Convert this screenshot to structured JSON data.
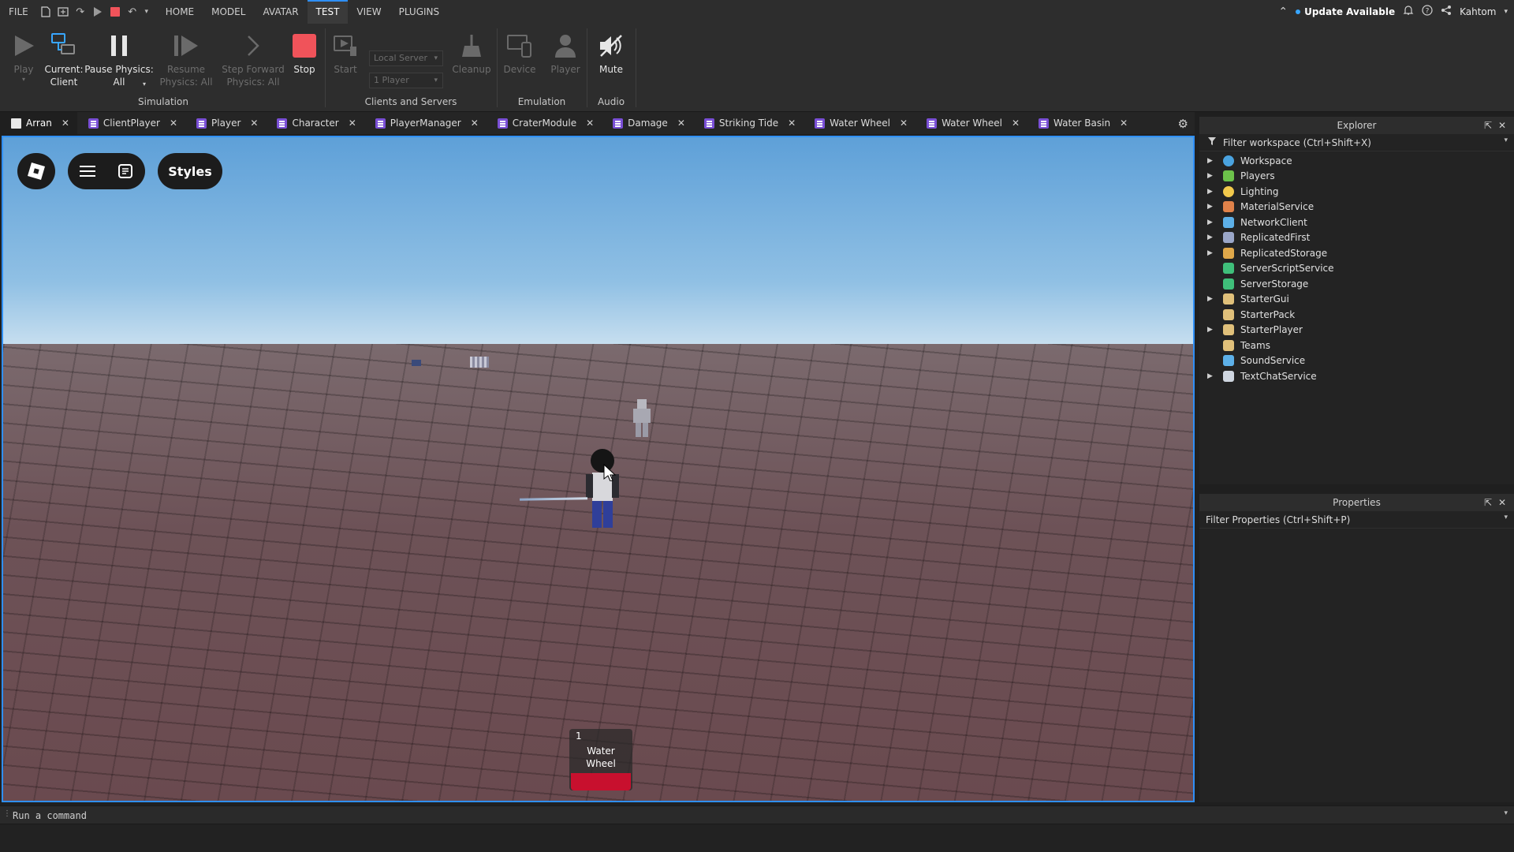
{
  "menubar": {
    "file": "FILE",
    "tabs": [
      "HOME",
      "MODEL",
      "AVATAR",
      "TEST",
      "VIEW",
      "PLUGINS"
    ],
    "active_tab": "TEST",
    "update_text": "Update Available",
    "username": "Kahtom"
  },
  "ribbon": {
    "play_label": "Play",
    "current_label_1": "Current:",
    "current_label_2": "Client",
    "pause_label_1": "Pause Physics:",
    "pause_label_2": "All",
    "resume_label_1": "Resume",
    "resume_label_2": "Physics: All",
    "step_label_1": "Step Forward",
    "step_label_2": "Physics: All",
    "stop_label": "Stop",
    "start_label": "Start",
    "server_select": "Local Server",
    "players_select": "1 Player",
    "cleanup_label": "Cleanup",
    "device_label": "Device",
    "player_label": "Player",
    "mute_label": "Mute",
    "group_simulation": "Simulation",
    "group_clients": "Clients and Servers",
    "group_emulation": "Emulation",
    "group_audio": "Audio",
    "stop_color": "#f0535a"
  },
  "doc_tabs": [
    {
      "label": "Arran",
      "icon": "doc"
    },
    {
      "label": "ClientPlayer",
      "icon": "script"
    },
    {
      "label": "Player",
      "icon": "script"
    },
    {
      "label": "Character",
      "icon": "script"
    },
    {
      "label": "PlayerManager",
      "icon": "script"
    },
    {
      "label": "CraterModule",
      "icon": "script"
    },
    {
      "label": "Damage",
      "icon": "script"
    },
    {
      "label": "Striking Tide",
      "icon": "script"
    },
    {
      "label": "Water Wheel",
      "icon": "script"
    },
    {
      "label": "Water Wheel",
      "icon": "script"
    },
    {
      "label": "Water Basin",
      "icon": "script"
    }
  ],
  "viewport": {
    "styles_label": "Styles",
    "hotbar": {
      "slot": "1",
      "name_1": "Water",
      "name_2": "Wheel"
    }
  },
  "command_bar": {
    "placeholder": "Run a command"
  },
  "explorer": {
    "title": "Explorer",
    "filter": "Filter workspace (Ctrl+Shift+X)",
    "items": [
      {
        "label": "Workspace",
        "expandable": true,
        "color": "#4aa3e0"
      },
      {
        "label": "Players",
        "expandable": true,
        "color": "#6cc24a"
      },
      {
        "label": "Lighting",
        "expandable": true,
        "color": "#f2c94c"
      },
      {
        "label": "MaterialService",
        "expandable": true,
        "color": "#e0824a"
      },
      {
        "label": "NetworkClient",
        "expandable": true,
        "color": "#5db0e8"
      },
      {
        "label": "ReplicatedFirst",
        "expandable": true,
        "color": "#9aa6c8"
      },
      {
        "label": "ReplicatedStorage",
        "expandable": true,
        "color": "#e0a84a"
      },
      {
        "label": "ServerScriptService",
        "expandable": false,
        "color": "#3fbf7a"
      },
      {
        "label": "ServerStorage",
        "expandable": false,
        "color": "#3fbf7a"
      },
      {
        "label": "StarterGui",
        "expandable": true,
        "color": "#e0c07a"
      },
      {
        "label": "StarterPack",
        "expandable": false,
        "color": "#e0c07a"
      },
      {
        "label": "StarterPlayer",
        "expandable": true,
        "color": "#e0c07a"
      },
      {
        "label": "Teams",
        "expandable": false,
        "color": "#e0c07a"
      },
      {
        "label": "SoundService",
        "expandable": false,
        "color": "#5db0e8"
      },
      {
        "label": "TextChatService",
        "expandable": true,
        "color": "#cfd6e0"
      }
    ]
  },
  "properties": {
    "title": "Properties",
    "filter": "Filter Properties (Ctrl+Shift+P)"
  }
}
